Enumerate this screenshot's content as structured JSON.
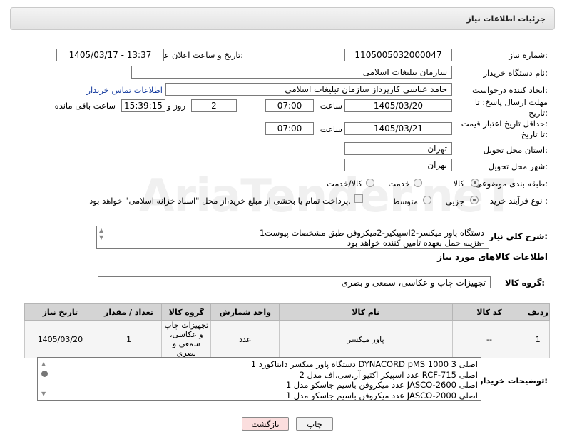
{
  "header": {
    "title": "جزئیات اطلاعات نیاز"
  },
  "fields": {
    "need_number_label": "شماره نیاز:",
    "need_number": "1105005032000047",
    "announce_label": "تاریخ و ساعت اعلان عمومی:",
    "announce_value": "1405/03/17 - 13:37",
    "buyer_org_label": "نام دستگاه خریدار:",
    "buyer_org": "سازمان تبلیغات اسلامی",
    "creator_label": "ایجاد کننده درخواست:",
    "creator": "حامد عباسی کارپرداز سازمان تبلیغات اسلامی",
    "contact_link": "اطلاعات تماس خریدار",
    "deadline_label_1": "مهلت ارسال پاسخ: تا",
    "deadline_label_2": "تاریخ:",
    "deadline_date": "1405/03/20",
    "hour_label": "ساعت",
    "deadline_time": "07:00",
    "days_value": "2",
    "days_label": "روز و",
    "remaining_time": "15:39:15",
    "remaining_label": "ساعت باقی مانده",
    "validity_label_1": "حداقل تاریخ اعتبار قیمت:",
    "validity_label_2": "تا تاریخ:",
    "validity_date": "1405/03/21",
    "validity_time": "07:00",
    "province_label": "استان محل تحویل:",
    "province": "تهران",
    "city_label": "شهر محل تحویل:",
    "city": "تهران",
    "category_label": "طبقه بندی موضوعی:",
    "category_options": [
      "کالا",
      "خدمت",
      "کالا/خدمت"
    ],
    "process_label": "نوع فرآیند خرید :",
    "process_options": [
      "جزیی",
      "متوسط"
    ],
    "payment_note": "پرداخت تمام یا بخشی از مبلغ خرید،از محل \"اسناد خزانه اسلامی\" خواهد بود."
  },
  "description": {
    "label": "شرح کلی نیاز:",
    "line1": "1دستگاه پاور میکسر-2اسپیکیر-2میکروفن طبق مشخصات پیوست",
    "line2": "هزینه حمل بعهده تامین کننده خواهد بود-"
  },
  "goods_section": {
    "title": "اطلاعات کالاهای مورد نیاز",
    "group_label": "گروه کالا:",
    "group_value": "تجهیزات چاپ و عکاسی، سمعی و بصری"
  },
  "table": {
    "headers": [
      "ردیف",
      "کد کالا",
      "نام کالا",
      "واحد شمارش",
      "گروه کالا",
      "تعداد / مقدار",
      "تاریخ نیاز"
    ],
    "rows": [
      {
        "row": "1",
        "code": "--",
        "name": "پاور میکسر",
        "unit": "عدد",
        "group": "تجهیزات چاپ و عکاسی، سمعی و بصری",
        "qty": "1",
        "date": "1405/03/20"
      }
    ]
  },
  "buyer_notes": {
    "label": "توضیحات خریدار:",
    "lines": [
      "1 دستگاه پاور میکسر داینا‌کورد DYNACORD pMS 1000 3 اصلی",
      "2 عدد اسپیکر اکتیو آر.سی.اف مدل RCF-715 اصلی",
      "1 عدد میکروفن باسیم جاسکو مدل JASCO-2600 اصلی",
      "1 عدد میکروفن باسیم جاسکو مدل JASCO-2000 اصلی"
    ]
  },
  "buttons": {
    "print": "چاپ",
    "back": "بازگشت"
  },
  "watermark": {
    "text": "AriaTender.neT",
    "color": "#c8c8c8"
  }
}
